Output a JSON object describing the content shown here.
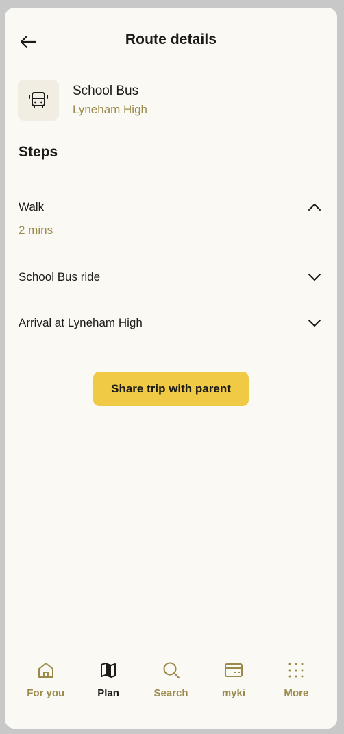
{
  "header": {
    "title": "Route details",
    "back_icon": "arrow-left-icon"
  },
  "route": {
    "name": "School Bus",
    "destination": "Lyneham High",
    "icon": "bus-icon"
  },
  "steps": {
    "heading": "Steps",
    "items": [
      {
        "label": "Walk",
        "detail": "2 mins",
        "expanded": true,
        "icon": "chevron-up-icon"
      },
      {
        "label": "School Bus ride",
        "expanded": false,
        "icon": "chevron-down-icon"
      },
      {
        "label": "Arrival at Lyneham High",
        "expanded": false,
        "icon": "chevron-down-icon"
      }
    ]
  },
  "share_button": {
    "label": "Share trip with parent"
  },
  "bottom_nav": {
    "items": [
      {
        "label": "For you",
        "icon": "home-icon",
        "active": false
      },
      {
        "label": "Plan",
        "icon": "map-icon",
        "active": true
      },
      {
        "label": "Search",
        "icon": "search-icon",
        "active": false
      },
      {
        "label": "myki",
        "icon": "card-icon",
        "active": false
      },
      {
        "label": "More",
        "icon": "grid-dots-icon",
        "active": false
      }
    ]
  },
  "colors": {
    "background": "#fbf9f4",
    "accent_text": "#9a8a4c",
    "button": "#f0c945",
    "icon_tile": "#f1ede2"
  }
}
